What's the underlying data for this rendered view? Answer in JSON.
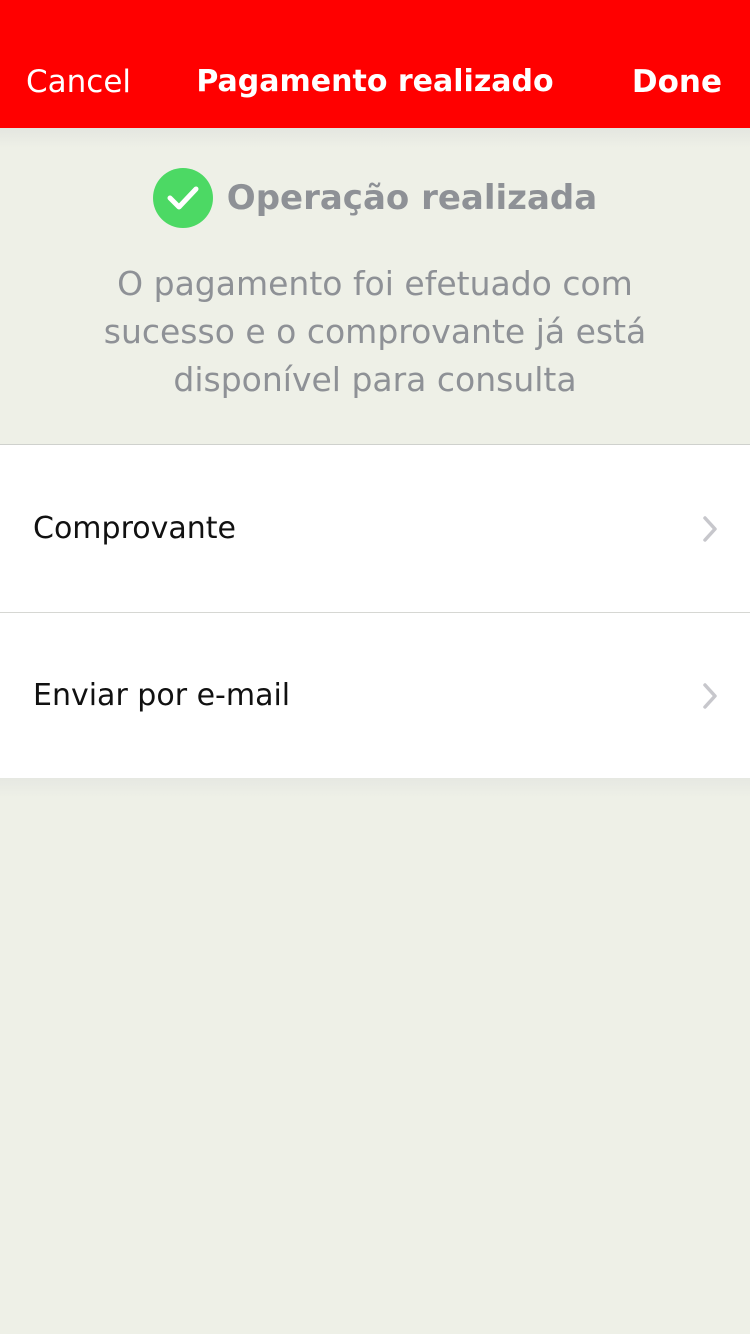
{
  "navbar": {
    "cancel_label": "Cancel",
    "title": "Pagamento realizado",
    "done_label": "Done",
    "background_color": "#ff0000"
  },
  "status": {
    "icon": "checkmark-circle-icon",
    "icon_color": "#4cd964",
    "title": "Operação realizada",
    "message": "O pagamento foi efetuado com sucesso e o comprovante já está disponível para consulta"
  },
  "options": [
    {
      "label": "Comprovante",
      "icon": "chevron-right-icon"
    },
    {
      "label": "Enviar por e-mail",
      "icon": "chevron-right-icon"
    }
  ]
}
